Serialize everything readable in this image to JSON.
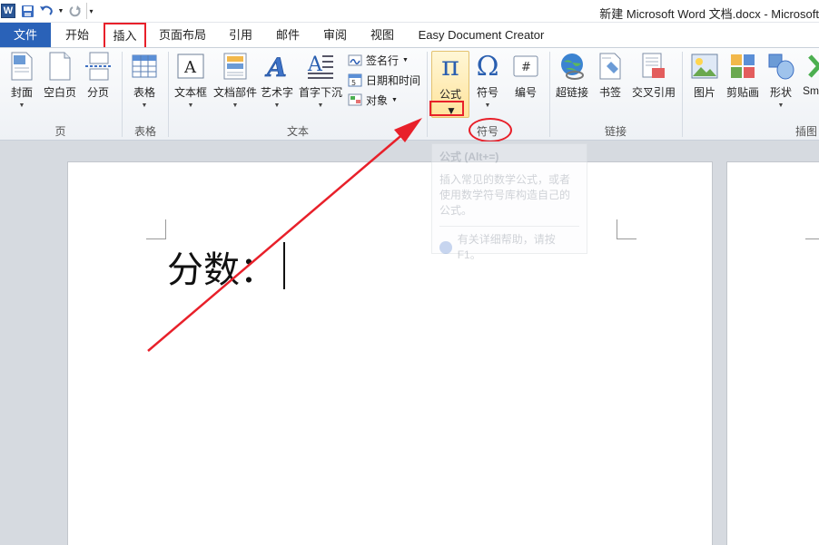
{
  "window": {
    "title": "新建 Microsoft Word 文档.docx - Microsoft"
  },
  "quick_access": {
    "app_icon": "W"
  },
  "tabs": [
    {
      "label": "文件"
    },
    {
      "label": "开始"
    },
    {
      "label": "插入"
    },
    {
      "label": "页面布局"
    },
    {
      "label": "引用"
    },
    {
      "label": "邮件"
    },
    {
      "label": "审阅"
    },
    {
      "label": "视图"
    },
    {
      "label": "Easy Document Creator"
    }
  ],
  "ribbon": {
    "page_group": {
      "label": "页",
      "cover": "封面",
      "blank": "空白页",
      "page_break": "分页"
    },
    "table_group": {
      "label": "表格",
      "table": "表格"
    },
    "text_group": {
      "label": "文本",
      "textbox": "文本框",
      "quick_parts": "文档部件",
      "wordart": "艺术字",
      "dropcap": "首字下沉",
      "signature": "签名行",
      "datetime": "日期和时间",
      "object": "对象"
    },
    "symbols_group": {
      "label": "符号",
      "equation": "公式",
      "symbol": "符号",
      "number": "编号",
      "pi_glyph": "π",
      "omega_glyph": "Ω",
      "hash_glyph": "#"
    },
    "links_group": {
      "label": "链接",
      "hyperlink": "超链接",
      "bookmark": "书签",
      "crossref": "交叉引用"
    },
    "illustrations_group": {
      "label": "插图",
      "picture": "图片",
      "clipart": "剪贴画",
      "shapes": "形状",
      "smartart": "Sm"
    }
  },
  "tooltip": {
    "title": "公式 (Alt+=)",
    "body": "插入常见的数学公式，或者使用数学符号库构造自己的公式。",
    "help": "有关详细帮助，请按 F1。"
  },
  "document": {
    "text": "分数："
  },
  "colors": {
    "file_tab": "#2a62b8",
    "highlight_red": "#e8202a",
    "ribbon_bg": "#eef1f5",
    "doc_bg": "#d6dae0"
  }
}
